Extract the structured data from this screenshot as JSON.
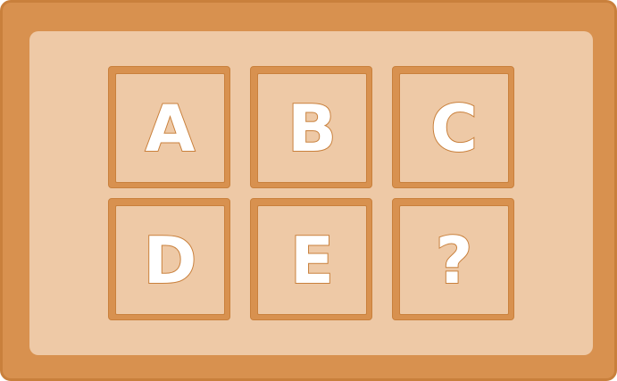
{
  "tiles": [
    {
      "label": "A"
    },
    {
      "label": "B"
    },
    {
      "label": "C"
    },
    {
      "label": "D"
    },
    {
      "label": "E"
    },
    {
      "label": "?"
    }
  ],
  "colors": {
    "frame": "#d8914f",
    "frame_border": "#c9803c",
    "panel": "#eec9a6",
    "letter_fill": "#ffffff",
    "letter_outline": "#c9803c"
  }
}
